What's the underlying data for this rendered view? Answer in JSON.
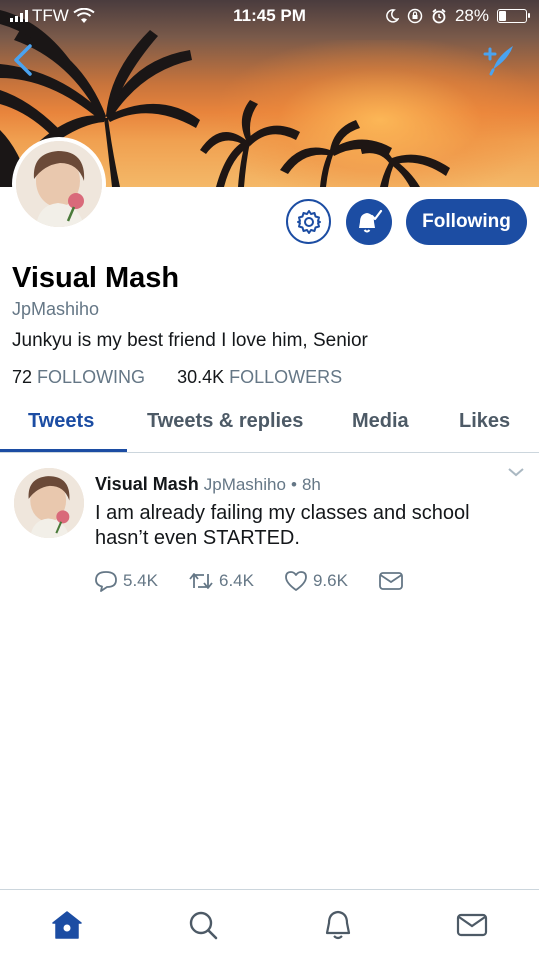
{
  "status_bar": {
    "carrier": "TFW",
    "time": "11:45 PM",
    "battery_percent": "28%",
    "battery_level": 0.28
  },
  "header": {
    "back_icon": "chevron-left-icon",
    "compose_icon": "compose-tweet-icon"
  },
  "profile": {
    "display_name": "Visual Mash",
    "handle": "JpMashiho",
    "bio": "Junkyu is my best friend I love him, Senior",
    "following_count": "72",
    "following_label": "FOLLOWING",
    "followers_count": "30.4K",
    "followers_label": "FOLLOWERS",
    "follow_button_label": "Following"
  },
  "tabs": [
    {
      "label": "Tweets",
      "active": true
    },
    {
      "label": "Tweets & replies",
      "active": false
    },
    {
      "label": "Media",
      "active": false
    },
    {
      "label": "Likes",
      "active": false
    }
  ],
  "tweet": {
    "author_name": "Visual Mash",
    "author_handle": "JpMashiho",
    "separator": "•",
    "time": "8h",
    "text": "I am already failing my classes and school hasn’t even STARTED.",
    "replies": "5.4K",
    "retweets": "6.4K",
    "likes": "9.6K"
  },
  "bottom_nav": [
    {
      "icon": "home-icon",
      "active": true
    },
    {
      "icon": "search-icon",
      "active": false
    },
    {
      "icon": "notifications-bell-icon",
      "active": false
    },
    {
      "icon": "messages-envelope-icon",
      "active": false
    }
  ],
  "colors": {
    "accent": "#1c4da3",
    "secondary_text": "#657786",
    "divider": "#ccd6dd"
  }
}
